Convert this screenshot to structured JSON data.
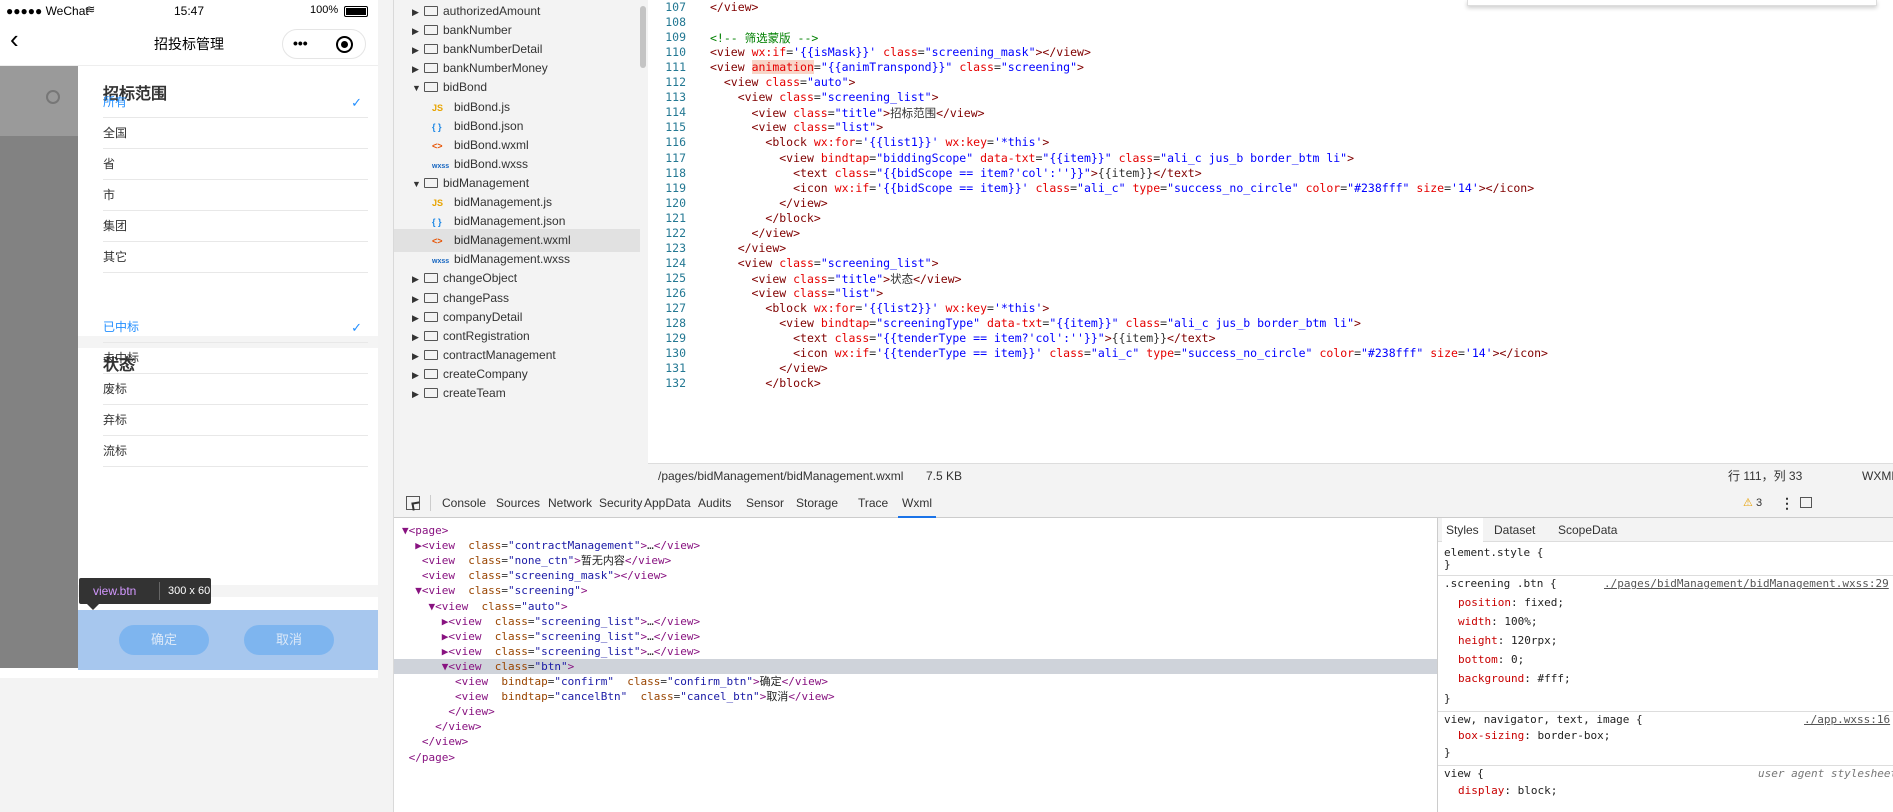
{
  "phone": {
    "status": {
      "carrier": "●●●●● WeChat",
      "time": "15:47",
      "battery": "100%"
    },
    "nav": {
      "title": "招投标管理",
      "more": "•••",
      "back": "‹"
    },
    "sections": [
      {
        "title": "招标范围",
        "items": [
          {
            "label": "所有",
            "selected": true
          },
          {
            "label": "全国",
            "selected": false
          },
          {
            "label": "省",
            "selected": false
          },
          {
            "label": "市",
            "selected": false
          },
          {
            "label": "集团",
            "selected": false
          },
          {
            "label": "其它",
            "selected": false
          }
        ]
      },
      {
        "title": "状态",
        "items": [
          {
            "label": "已中标",
            "selected": true
          },
          {
            "label": "未中标",
            "selected": false
          },
          {
            "label": "废标",
            "selected": false
          },
          {
            "label": "弃标",
            "selected": false
          },
          {
            "label": "流标",
            "selected": false
          }
        ]
      }
    ],
    "tooltip": {
      "selector": "view.btn",
      "size": "300 x 60"
    },
    "confirm": "确定",
    "cancel": "取消",
    "accent": "#238fff"
  },
  "tree": [
    {
      "label": "authorizedAmount",
      "type": "folder",
      "open": false,
      "depth": 0
    },
    {
      "label": "bankNumber",
      "type": "folder",
      "open": false,
      "depth": 0
    },
    {
      "label": "bankNumberDetail",
      "type": "folder",
      "open": false,
      "depth": 0
    },
    {
      "label": "bankNumberMoney",
      "type": "folder",
      "open": false,
      "depth": 0
    },
    {
      "label": "bidBond",
      "type": "folder",
      "open": true,
      "depth": 0
    },
    {
      "label": "bidBond.js",
      "type": "js",
      "depth": 1
    },
    {
      "label": "bidBond.json",
      "type": "json",
      "depth": 1
    },
    {
      "label": "bidBond.wxml",
      "type": "wxml",
      "depth": 1
    },
    {
      "label": "bidBond.wxss",
      "type": "wxss",
      "depth": 1
    },
    {
      "label": "bidManagement",
      "type": "folder",
      "open": true,
      "depth": 0
    },
    {
      "label": "bidManagement.js",
      "type": "js",
      "depth": 1
    },
    {
      "label": "bidManagement.json",
      "type": "json",
      "depth": 1
    },
    {
      "label": "bidManagement.wxml",
      "type": "wxml",
      "depth": 1,
      "active": true
    },
    {
      "label": "bidManagement.wxss",
      "type": "wxss",
      "depth": 1
    },
    {
      "label": "changeObject",
      "type": "folder",
      "open": false,
      "depth": 0
    },
    {
      "label": "changePass",
      "type": "folder",
      "open": false,
      "depth": 0
    },
    {
      "label": "companyDetail",
      "type": "folder",
      "open": false,
      "depth": 0
    },
    {
      "label": "contRegistration",
      "type": "folder",
      "open": false,
      "depth": 0
    },
    {
      "label": "contractManagement",
      "type": "folder",
      "open": false,
      "depth": 0
    },
    {
      "label": "createCompany",
      "type": "folder",
      "open": false,
      "depth": 0
    },
    {
      "label": "createTeam",
      "type": "folder",
      "open": false,
      "depth": 0
    }
  ],
  "file_icons": {
    "js": "JS",
    "json": "{ }",
    "wxml": "<>",
    "wxss": "wxss"
  },
  "editor": {
    "lines": [
      {
        "n": "107",
        "html": "<span class='t'>&lt;/view&gt;</span>"
      },
      {
        "n": "108",
        "html": ""
      },
      {
        "n": "109",
        "html": "<span class='c'>&lt;!-- 筛选蒙版 --&gt;</span>"
      },
      {
        "n": "110",
        "html": "<span class='t'>&lt;view</span> <span class='a'>wx:if</span>=<span class='v'>'{{isMask}}'</span> <span class='a'>class</span>=<span class='v'>\"screening_mask\"</span><span class='t'>&gt;&lt;/view&gt;</span>"
      },
      {
        "n": "111",
        "html": "<span class='t'>&lt;view</span> <span class='a hl'>animation</span>=<span class='v'>\"{{animTranspond}}\"</span> <span class='a'>class</span>=<span class='v'>\"screening\"</span><span class='t'>&gt;</span>"
      },
      {
        "n": "112",
        "html": "  <span class='t'>&lt;view</span> <span class='a'>class</span>=<span class='v'>\"auto\"</span><span class='t'>&gt;</span>"
      },
      {
        "n": "113",
        "html": "    <span class='t'>&lt;view</span> <span class='a'>class</span>=<span class='v'>\"screening_list\"</span><span class='t'>&gt;</span>"
      },
      {
        "n": "114",
        "html": "      <span class='t'>&lt;view</span> <span class='a'>class</span>=<span class='v'>\"title\"</span><span class='t'>&gt;</span>招标范围<span class='t'>&lt;/view&gt;</span>"
      },
      {
        "n": "115",
        "html": "      <span class='t'>&lt;view</span> <span class='a'>class</span>=<span class='v'>\"list\"</span><span class='t'>&gt;</span>"
      },
      {
        "n": "116",
        "html": "        <span class='t'>&lt;block</span> <span class='a'>wx:for</span>=<span class='v'>'{{list1}}'</span> <span class='a'>wx:key</span>=<span class='v'>'*this'</span><span class='t'>&gt;</span>"
      },
      {
        "n": "117",
        "html": "          <span class='t'>&lt;view</span> <span class='a'>bindtap</span>=<span class='v'>\"biddingScope\"</span> <span class='a'>data-txt</span>=<span class='v'>\"{{item}}\"</span> <span class='a'>class</span>=<span class='v'>\"ali_c jus_b border_btm li\"</span><span class='t'>&gt;</span>"
      },
      {
        "n": "118",
        "html": "            <span class='t'>&lt;text</span> <span class='a'>class</span>=<span class='v'>\"{{bidScope == item?'col':''}}\"</span><span class='t'>&gt;</span>{{item}}<span class='t'>&lt;/text&gt;</span>"
      },
      {
        "n": "119",
        "html": "            <span class='t'>&lt;icon</span> <span class='a'>wx:if</span>=<span class='v'>'{{bidScope == item}}'</span> <span class='a'>class</span>=<span class='v'>\"ali_c\"</span> <span class='a'>type</span>=<span class='v'>\"success_no_circle\"</span> <span class='a'>color</span>=<span class='v'>\"#238fff\"</span> <span class='a'>size</span>=<span class='v'>'14'</span><span class='t'>&gt;&lt;/icon&gt;</span>"
      },
      {
        "n": "120",
        "html": "          <span class='t'>&lt;/view&gt;</span>"
      },
      {
        "n": "121",
        "html": "        <span class='t'>&lt;/block&gt;</span>"
      },
      {
        "n": "122",
        "html": "      <span class='t'>&lt;/view&gt;</span>"
      },
      {
        "n": "123",
        "html": "    <span class='t'>&lt;/view&gt;</span>"
      },
      {
        "n": "124",
        "html": "    <span class='t'>&lt;view</span> <span class='a'>class</span>=<span class='v'>\"screening_list\"</span><span class='t'>&gt;</span>"
      },
      {
        "n": "125",
        "html": "      <span class='t'>&lt;view</span> <span class='a'>class</span>=<span class='v'>\"title\"</span><span class='t'>&gt;</span>状态<span class='t'>&lt;/view&gt;</span>"
      },
      {
        "n": "126",
        "html": "      <span class='t'>&lt;view</span> <span class='a'>class</span>=<span class='v'>\"list\"</span><span class='t'>&gt;</span>"
      },
      {
        "n": "127",
        "html": "        <span class='t'>&lt;block</span> <span class='a'>wx:for</span>=<span class='v'>'{{list2}}'</span> <span class='a'>wx:key</span>=<span class='v'>'*this'</span><span class='t'>&gt;</span>"
      },
      {
        "n": "128",
        "html": "          <span class='t'>&lt;view</span> <span class='a'>bindtap</span>=<span class='v'>\"screeningType\"</span> <span class='a'>data-txt</span>=<span class='v'>\"{{item}}\"</span> <span class='a'>class</span>=<span class='v'>\"ali_c jus_b border_btm li\"</span><span class='t'>&gt;</span>"
      },
      {
        "n": "129",
        "html": "            <span class='t'>&lt;text</span> <span class='a'>class</span>=<span class='v'>\"{{tenderType == item?'col':''}}\"</span><span class='t'>&gt;</span>{{item}}<span class='t'>&lt;/text&gt;</span>"
      },
      {
        "n": "130",
        "html": "            <span class='t'>&lt;icon</span> <span class='a'>wx:if</span>=<span class='v'>'{{tenderType == item}}'</span> <span class='a'>class</span>=<span class='v'>\"ali_c\"</span> <span class='a'>type</span>=<span class='v'>\"success_no_circle\"</span> <span class='a'>color</span>=<span class='v'>\"#238fff\"</span> <span class='a'>size</span>=<span class='v'>'14'</span><span class='t'>&gt;&lt;/icon&gt;</span>"
      },
      {
        "n": "131",
        "html": "          <span class='t'>&lt;/view&gt;</span>"
      },
      {
        "n": "132",
        "html": "        <span class='t'>&lt;/block&gt;</span>"
      }
    ]
  },
  "editor_status": {
    "path": "/pages/bidManagement/bidManagement.wxml",
    "size": "7.5 KB",
    "cursor": "行 111，列 33",
    "lang": "WXML"
  },
  "devtools": {
    "tabs": [
      "Console",
      "Sources",
      "Network",
      "Security",
      "AppData",
      "Audits",
      "Sensor",
      "Storage",
      "Trace",
      "Wxml"
    ],
    "active_tab": "Wxml",
    "warnings": "3"
  },
  "wxml_lines": [
    {
      "html": "<span class='tg'>▼&lt;page&gt;</span>",
      "sel": false
    },
    {
      "html": "  <span class='tg'>▶&lt;view</span>  <span class='at'>class</span>=<span class='av'>\"contractManagement\"</span><span class='tg'>&gt;</span>…<span class='tg'>&lt;/view&gt;</span>",
      "sel": false
    },
    {
      "html": "   <span class='tg'>&lt;view</span>  <span class='at'>class</span>=<span class='av'>\"none_ctn\"</span><span class='tg'>&gt;</span><span class='tx'>暂无内容</span><span class='tg'>&lt;/view&gt;</span>",
      "sel": false
    },
    {
      "html": "   <span class='tg'>&lt;view</span>  <span class='at'>class</span>=<span class='av'>\"screening_mask\"</span><span class='tg'>&gt;&lt;/view&gt;</span>",
      "sel": false
    },
    {
      "html": "  <span class='tg'>▼&lt;view</span>  <span class='at'>class</span>=<span class='av'>\"screening\"</span><span class='tg'>&gt;</span>",
      "sel": false
    },
    {
      "html": "    <span class='tg'>▼&lt;view</span>  <span class='at'>class</span>=<span class='av'>\"auto\"</span><span class='tg'>&gt;</span>",
      "sel": false
    },
    {
      "html": "      <span class='tg'>▶&lt;view</span>  <span class='at'>class</span>=<span class='av'>\"screening_list\"</span><span class='tg'>&gt;</span>…<span class='tg'>&lt;/view&gt;</span>",
      "sel": false
    },
    {
      "html": "      <span class='tg'>▶&lt;view</span>  <span class='at'>class</span>=<span class='av'>\"screening_list\"</span><span class='tg'>&gt;</span>…<span class='tg'>&lt;/view&gt;</span>",
      "sel": false
    },
    {
      "html": "      <span class='tg'>▶&lt;view</span>  <span class='at'>class</span>=<span class='av'>\"screening_list\"</span><span class='tg'>&gt;</span>…<span class='tg'>&lt;/view&gt;</span>",
      "sel": false
    },
    {
      "html": "      <span class='tg'>▼&lt;view</span>  <span class='at'>class</span>=<span class='av'>\"btn\"</span><span class='tg'>&gt;</span>",
      "sel": true
    },
    {
      "html": "        <span class='tg'>&lt;view</span>  <span class='at'>bindtap</span>=<span class='av'>\"confirm\"</span>  <span class='at'>class</span>=<span class='av'>\"confirm_btn\"</span><span class='tg'>&gt;</span><span class='tx'>确定</span><span class='tg'>&lt;/view&gt;</span>",
      "sel": false
    },
    {
      "html": "        <span class='tg'>&lt;view</span>  <span class='at'>bindtap</span>=<span class='av'>\"cancelBtn\"</span>  <span class='at'>class</span>=<span class='av'>\"cancel_btn\"</span><span class='tg'>&gt;</span><span class='tx'>取消</span><span class='tg'>&lt;/view&gt;</span>",
      "sel": false
    },
    {
      "html": "       <span class='tg'>&lt;/view&gt;</span>",
      "sel": false
    },
    {
      "html": "     <span class='tg'>&lt;/view&gt;</span>",
      "sel": false
    },
    {
      "html": "   <span class='tg'>&lt;/view&gt;</span>",
      "sel": false
    },
    {
      "html": " <span class='tg'>&lt;/page&gt;</span>",
      "sel": false
    }
  ],
  "styles": {
    "tabs": [
      "Styles",
      "Dataset",
      "ScopeData"
    ],
    "element_style": "element.style {",
    "rule1": {
      "selector": ".screening .btn {",
      "source": "./pages/bidManagement/bidManagement.wxss:29",
      "props": [
        [
          "position",
          "fixed;"
        ],
        [
          "width",
          "100%;"
        ],
        [
          "height",
          "120rpx;"
        ],
        [
          "bottom",
          "0;"
        ],
        [
          "background",
          "#fff;"
        ]
      ]
    },
    "rule2": {
      "selector": "view, navigator, text, image {",
      "source": "./app.wxss:16",
      "props": [
        [
          "box-sizing",
          "border-box;"
        ]
      ]
    },
    "rule3": {
      "selector": "view {",
      "source": "user agent stylesheet",
      "props": [
        [
          "display",
          "block;"
        ]
      ]
    },
    "close": "}"
  }
}
